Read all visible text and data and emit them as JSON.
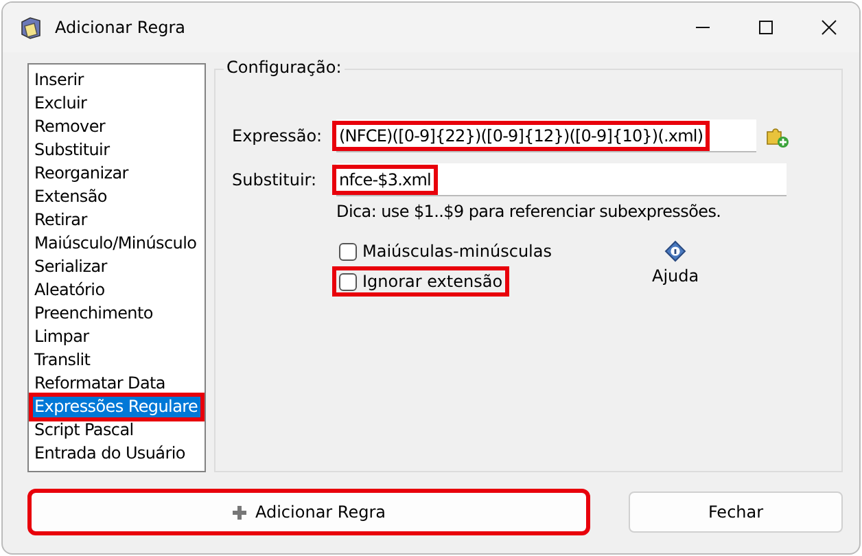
{
  "window": {
    "title": "Adicionar Regra"
  },
  "rule_list": {
    "items": [
      {
        "label": "Inserir",
        "selected": false,
        "highlighted": false
      },
      {
        "label": "Excluir",
        "selected": false,
        "highlighted": false
      },
      {
        "label": "Remover",
        "selected": false,
        "highlighted": false
      },
      {
        "label": "Substituir",
        "selected": false,
        "highlighted": false
      },
      {
        "label": "Reorganizar",
        "selected": false,
        "highlighted": false
      },
      {
        "label": "Extensão",
        "selected": false,
        "highlighted": false
      },
      {
        "label": "Retirar",
        "selected": false,
        "highlighted": false
      },
      {
        "label": "Maiúsculo/Minúsculo",
        "selected": false,
        "highlighted": false
      },
      {
        "label": "Serializar",
        "selected": false,
        "highlighted": false
      },
      {
        "label": "Aleatório",
        "selected": false,
        "highlighted": false
      },
      {
        "label": "Preenchimento",
        "selected": false,
        "highlighted": false
      },
      {
        "label": "Limpar",
        "selected": false,
        "highlighted": false
      },
      {
        "label": "Translit",
        "selected": false,
        "highlighted": false
      },
      {
        "label": "Reformatar Data",
        "selected": false,
        "highlighted": false
      },
      {
        "label": "Expressões Regulare",
        "selected": true,
        "highlighted": true
      },
      {
        "label": "Script Pascal",
        "selected": false,
        "highlighted": false
      },
      {
        "label": "Entrada do Usuário",
        "selected": false,
        "highlighted": false
      }
    ]
  },
  "config": {
    "title": "Configuração:",
    "expression": {
      "label": "Expressão:",
      "value": "(NFCE)([0-9]{22})([0-9]{12})([0-9]{10})(.xml)",
      "highlighted": true
    },
    "replace": {
      "label": "Substituir:",
      "value": "nfce-$3.xml",
      "highlighted": true
    },
    "hint": "Dica: use $1..$9 para referenciar subexpressões.",
    "options": [
      {
        "label": "Maiúsculas-minúsculas",
        "checked": false,
        "highlighted": false
      },
      {
        "label": "Ignorar extensão",
        "checked": false,
        "highlighted": true
      }
    ],
    "help": "Ajuda"
  },
  "buttons": [
    {
      "label": "Adicionar Regra",
      "kind": "add",
      "highlighted": true
    },
    {
      "label": "Fechar",
      "kind": "plain",
      "highlighted": false
    }
  ]
}
